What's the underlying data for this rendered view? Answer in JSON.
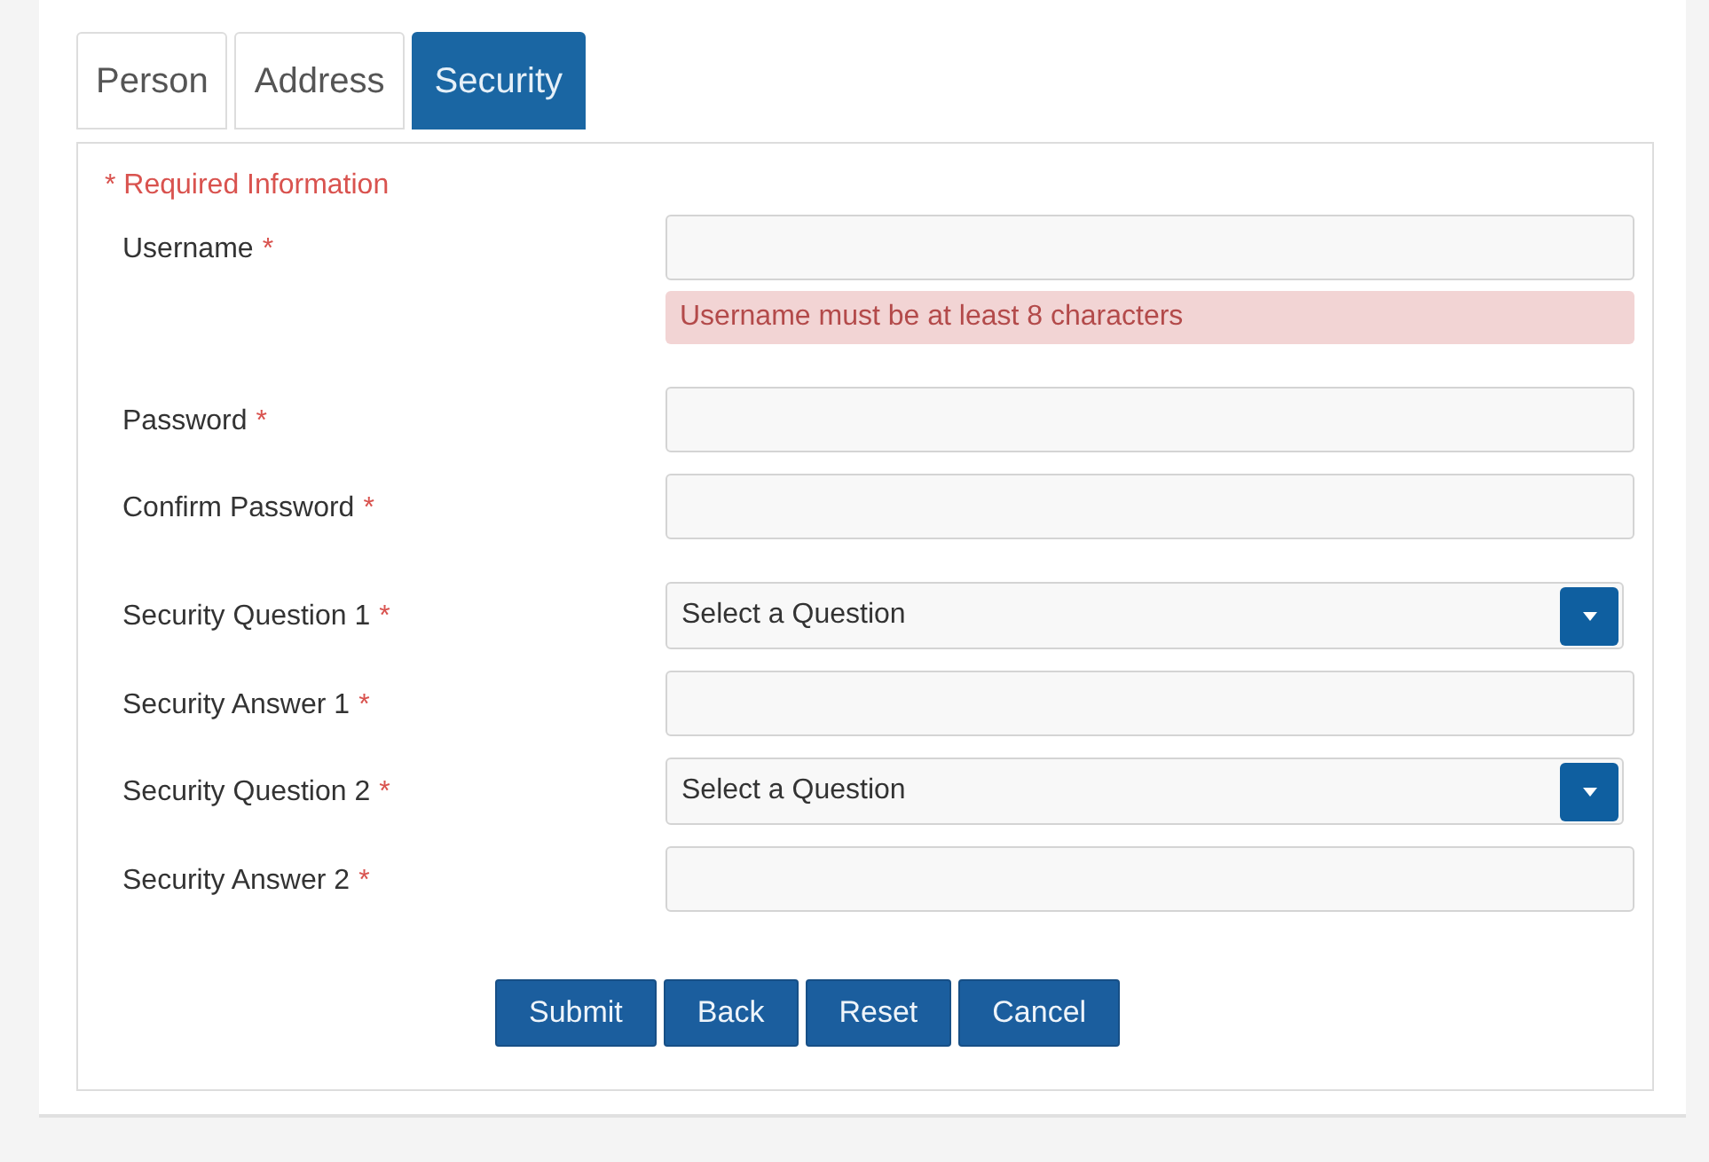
{
  "tabs": [
    {
      "label": "Person",
      "selected": false
    },
    {
      "label": "Address",
      "selected": false
    },
    {
      "label": "Security",
      "selected": true
    }
  ],
  "required_note": "* Required Information",
  "sections": [
    {
      "fields": [
        {
          "kind": "text",
          "label": "Username",
          "required_mark": "*",
          "error": "Username must be at least 8 characters"
        }
      ]
    },
    {
      "fields": [
        {
          "kind": "text",
          "label": "Password",
          "required_mark": "*"
        },
        {
          "kind": "text",
          "label": "Confirm Password",
          "required_mark": "*"
        }
      ]
    },
    {
      "fields": [
        {
          "kind": "select",
          "label": "Security Question 1",
          "required_mark": "*",
          "value": "Select a Question"
        },
        {
          "kind": "text",
          "label": "Security Answer 1",
          "required_mark": "*"
        },
        {
          "kind": "select",
          "label": "Security Question 2",
          "required_mark": "*",
          "value": "Select a Question"
        },
        {
          "kind": "text",
          "label": "Security Answer 2",
          "required_mark": "*"
        }
      ]
    }
  ],
  "buttons": [
    "Submit",
    "Back",
    "Reset",
    "Cancel"
  ]
}
